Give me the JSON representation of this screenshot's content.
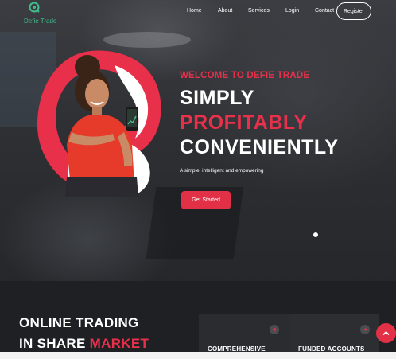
{
  "brand": {
    "name": "Defie Trade",
    "accent": "#e8304a",
    "logo_color": "#3fbf8a",
    "logo_icon": "logo-mark-icon"
  },
  "nav": {
    "items": [
      {
        "label": "Home"
      },
      {
        "label": "About"
      },
      {
        "label": "Services"
      },
      {
        "label": "Login"
      },
      {
        "label": "Contact"
      }
    ],
    "register_label": "Register"
  },
  "hero": {
    "welcome": "WELCOME TO DEFIE TRADE",
    "line1": "SIMPLY",
    "line2": "PROFITABLY",
    "line3": "CONVENIENTLY",
    "tagline": "A simple, intelligent and empowering",
    "cta_label": "Get Started",
    "slider": {
      "active": 1
    }
  },
  "section": {
    "title_line1": "ONLINE TRADING",
    "title_line2_prefix": "IN SHARE ",
    "title_line2_accent": "MARKET",
    "cards": [
      {
        "title": "COMPREHENSIVE",
        "icon": "arrow-right-icon"
      },
      {
        "title": "FUNDED ACCOUNTS",
        "icon": "arrow-right-icon"
      }
    ]
  },
  "back_to_top_icon": "chevron-up-icon"
}
